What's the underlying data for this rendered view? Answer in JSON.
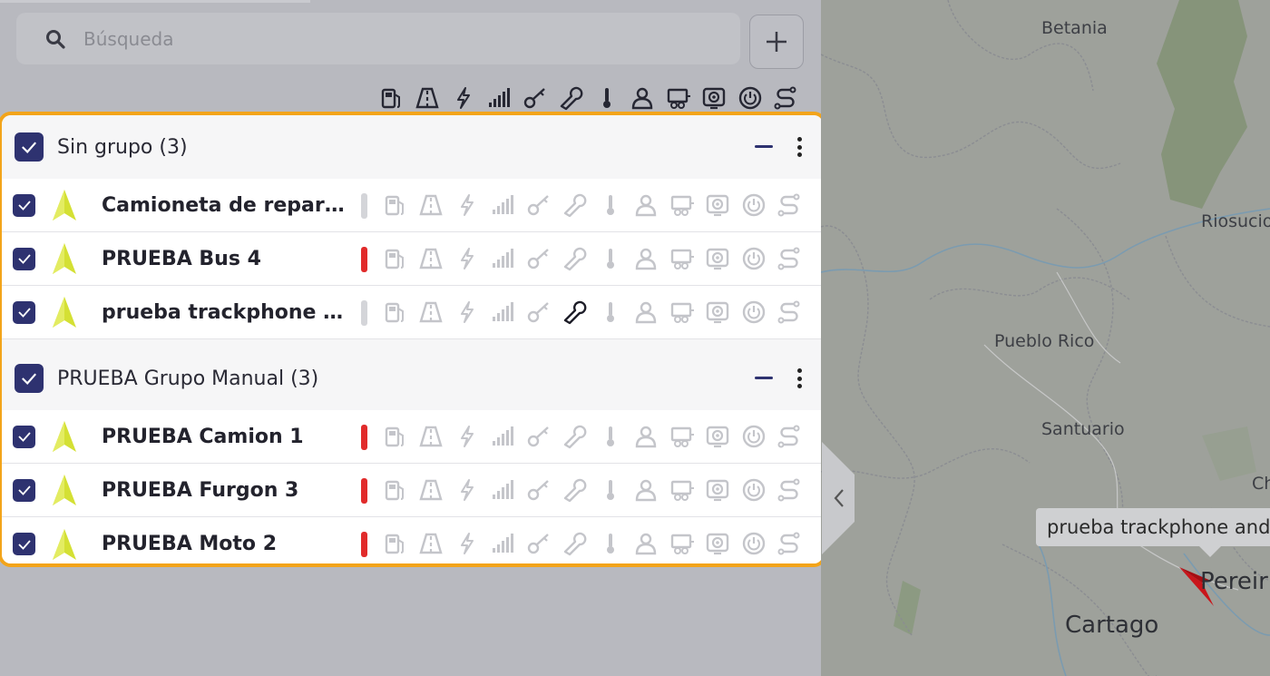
{
  "search": {
    "placeholder": "Búsqueda"
  },
  "add_button": {
    "label": "+"
  },
  "header_icons": [
    "fuel-icon",
    "road-icon",
    "lightning-icon",
    "signal-icon",
    "key-icon",
    "wrench-icon",
    "thermometer-icon",
    "driver-icon",
    "trailer-icon",
    "camera-icon",
    "power-icon",
    "route-icon"
  ],
  "groups": [
    {
      "name": "Sin grupo (3)",
      "vehicles": [
        {
          "name": "Camioneta de reparto",
          "status_color": "#d4d5d9",
          "active_icon": ""
        },
        {
          "name": "PRUEBA Bus 4",
          "status_color": "#e12b2b",
          "active_icon": ""
        },
        {
          "name": "prueba trackphone a...",
          "status_color": "#d4d5d9",
          "active_icon": "wrench-icon"
        }
      ]
    },
    {
      "name": "PRUEBA Grupo Manual (3)",
      "vehicles": [
        {
          "name": "PRUEBA Camion 1",
          "status_color": "#e12b2b",
          "active_icon": ""
        },
        {
          "name": "PRUEBA Furgon 3",
          "status_color": "#e12b2b",
          "active_icon": ""
        },
        {
          "name": "PRUEBA Moto 2",
          "status_color": "#e12b2b",
          "active_icon": ""
        }
      ]
    }
  ],
  "colors": {
    "accent": "#2e3270",
    "highlight_border": "#f3a41a",
    "vehicle_arrow": "#d4e034",
    "inactive_icon": "#c4c5ca",
    "active_icon": "#1d1d28"
  },
  "map": {
    "places": [
      {
        "name": "Betania"
      },
      {
        "name": "Riosucio"
      },
      {
        "name": "Pueblo Rico"
      },
      {
        "name": "Santuario"
      },
      {
        "name": "Ch"
      },
      {
        "name": "Pereir"
      },
      {
        "name": "Cartago"
      }
    ],
    "tooltip": "prueba trackphone and"
  }
}
